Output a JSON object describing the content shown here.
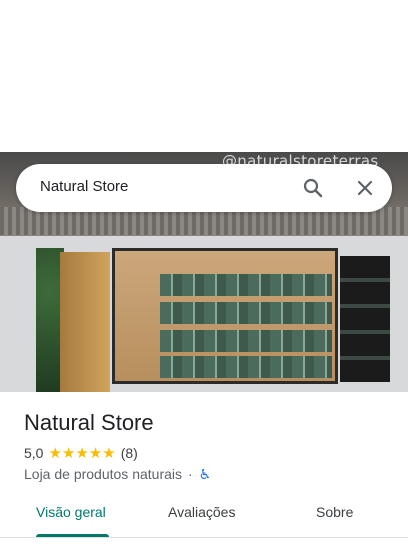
{
  "search": {
    "query": "Natural Store"
  },
  "hero": {
    "sign_text": "@naturalstoreterras"
  },
  "place": {
    "name": "Natural Store",
    "rating": "5,0",
    "stars": "★★★★★",
    "review_count": "(8)",
    "category": "Loja de produtos naturais",
    "separator": "·",
    "accessibility_icon": "♿"
  },
  "tabs": [
    {
      "label": "Visão geral",
      "active": true
    },
    {
      "label": "Avaliações",
      "active": false
    },
    {
      "label": "Sobre",
      "active": false
    }
  ],
  "colors": {
    "accent": "#00796b",
    "stars": "#fbbc04",
    "accessibility": "#1a73e8"
  }
}
